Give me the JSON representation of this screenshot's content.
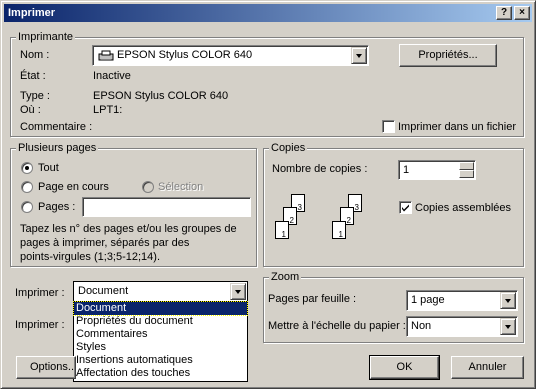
{
  "title": "Imprimer",
  "titlebar": {
    "help": "?",
    "close": "×"
  },
  "printer_group": {
    "title": "Imprimante",
    "name_label": "Nom :",
    "name_value": "EPSON Stylus COLOR 640",
    "properties_button": "Propriétés...",
    "state_label": "État :",
    "state_value": "Inactive",
    "type_label": "Type :",
    "type_value": "EPSON Stylus COLOR 640",
    "where_label": "Où :",
    "where_value": "LPT1:",
    "comment_label": "Commentaire :",
    "print_to_file_label": "Imprimer dans un fichier",
    "print_to_file_checked": false
  },
  "pages_group": {
    "title": "Plusieurs pages",
    "all_label": "Tout",
    "current_label": "Page en cours",
    "selection_label": "Sélection",
    "pages_label": "Pages :",
    "pages_value": "",
    "hint": [
      "Tapez les n° des pages et/ou les groupes de",
      "pages à imprimer, séparés par des",
      "points-virgules (1;3;5-12;14)."
    ]
  },
  "copies_group": {
    "title": "Copies",
    "count_label": "Nombre de copies :",
    "count_value": "1",
    "collate_label": "Copies assemblées",
    "collate_checked": true,
    "page_numbers": [
      "3",
      "2",
      "1",
      "3",
      "2",
      "1"
    ]
  },
  "print_what": {
    "label": "Imprimer :",
    "value": "Document",
    "options": [
      "Document",
      "Propriétés du document",
      "Commentaires",
      "Styles",
      "Insertions automatiques",
      "Affectation des touches"
    ]
  },
  "print_range": {
    "label": "Imprimer :"
  },
  "zoom_group": {
    "title": "Zoom",
    "pages_per_sheet_label": "Pages par feuille :",
    "pages_per_sheet_value": "1 page",
    "scale_label": "Mettre à l'échelle du papier :",
    "scale_value": "Non"
  },
  "buttons": {
    "options": "Options...",
    "ok": "OK",
    "cancel": "Annuler"
  },
  "colors": {
    "face": "#d4d0c8",
    "title_start": "#0a246a",
    "title_end": "#a6caf0",
    "highlight": "#0a246a"
  }
}
